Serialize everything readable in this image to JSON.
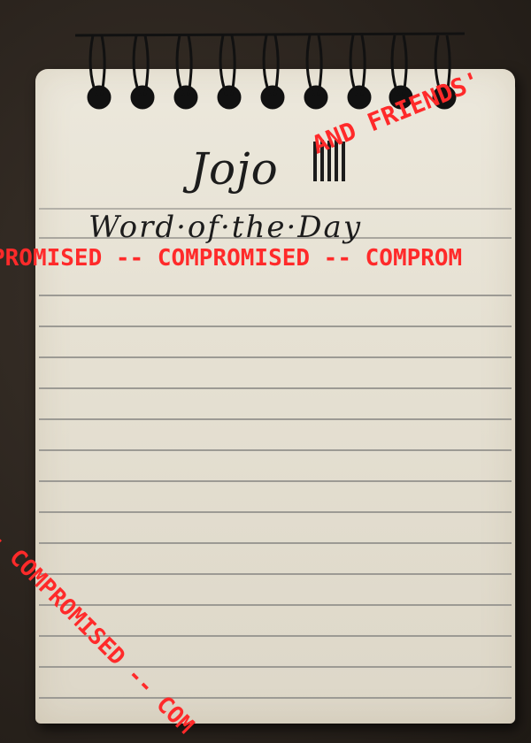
{
  "notepad": {
    "title": "Jojo",
    "subtitle": "Word·of·the·Day"
  },
  "stamps": {
    "friends": "AND FRIENDS'",
    "band_horizontal": "PROMISED -- COMPROMISED -- COMPROM",
    "band_diagonal": "D -- COMPROMISED -- COM"
  },
  "colors": {
    "stamp": "#ff2a2a",
    "paper": "#e6e1d3",
    "background": "#2b241e",
    "ink": "#1c1c1c"
  }
}
